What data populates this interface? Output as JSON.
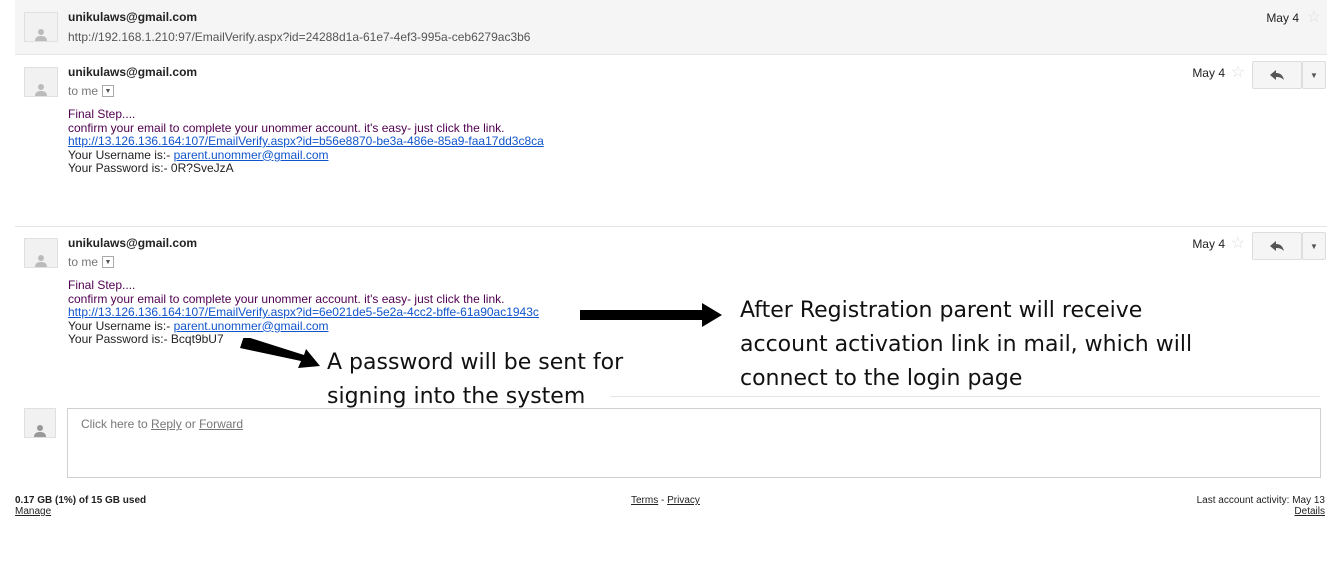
{
  "messages": [
    {
      "sender": "unikulaws@gmail.com",
      "snippet": "http://192.168.1.210:97/EmailVerify.aspx?id=24288d1a-61e7-4ef3-995a-ceb6279ac3b6",
      "date": "May 4"
    },
    {
      "sender": "unikulaws@gmail.com",
      "to": "to me",
      "date": "May 4",
      "line1": "Final Step....",
      "line2": "confirm your email to complete your unommer account. it's easy- just click the link.",
      "link": "http://13.126.136.164:107/EmailVerify.aspx?id=b56e8870-be3a-486e-85a9-faa17dd3c8ca",
      "username_label": "Your Username is:- ",
      "username": "parent.unommer@gmail.com",
      "password_line": "Your Password is:- 0R?SveJzA"
    },
    {
      "sender": "unikulaws@gmail.com",
      "to": "to me",
      "date": "May 4",
      "line1": "Final Step....",
      "line2": "confirm your email to complete your unommer account. it's easy- just click the link.",
      "link": "http://13.126.136.164:107/EmailVerify.aspx?id=6e021de5-5e2a-4cc2-bffe-61a90ac1943c",
      "username_label": "Your Username is:- ",
      "username": "parent.unommer@gmail.com",
      "password_line": "Your Password is:- Bcqt9bU7"
    }
  ],
  "annotations": {
    "right_line1": "After Registration parent will receive",
    "right_line2": "account activation link in mail, which will",
    "right_line3": "connect to the login page",
    "left_line1": "A password will be sent for",
    "left_line2": "signing  into the system"
  },
  "reply": {
    "prefix": "Click here to ",
    "reply_link": "Reply",
    "or": " or ",
    "forward_link": "Forward"
  },
  "footer": {
    "storage": "0.17 GB (1%) of 15 GB used",
    "manage": "Manage",
    "terms": "Terms",
    "sep": " - ",
    "privacy": "Privacy",
    "last_activity": "Last account activity: May 13",
    "details": "Details"
  },
  "icons": {
    "star": "star-icon",
    "reply": "reply-arrow-icon",
    "more": "chevron-down-icon",
    "avatar": "person-icon"
  }
}
